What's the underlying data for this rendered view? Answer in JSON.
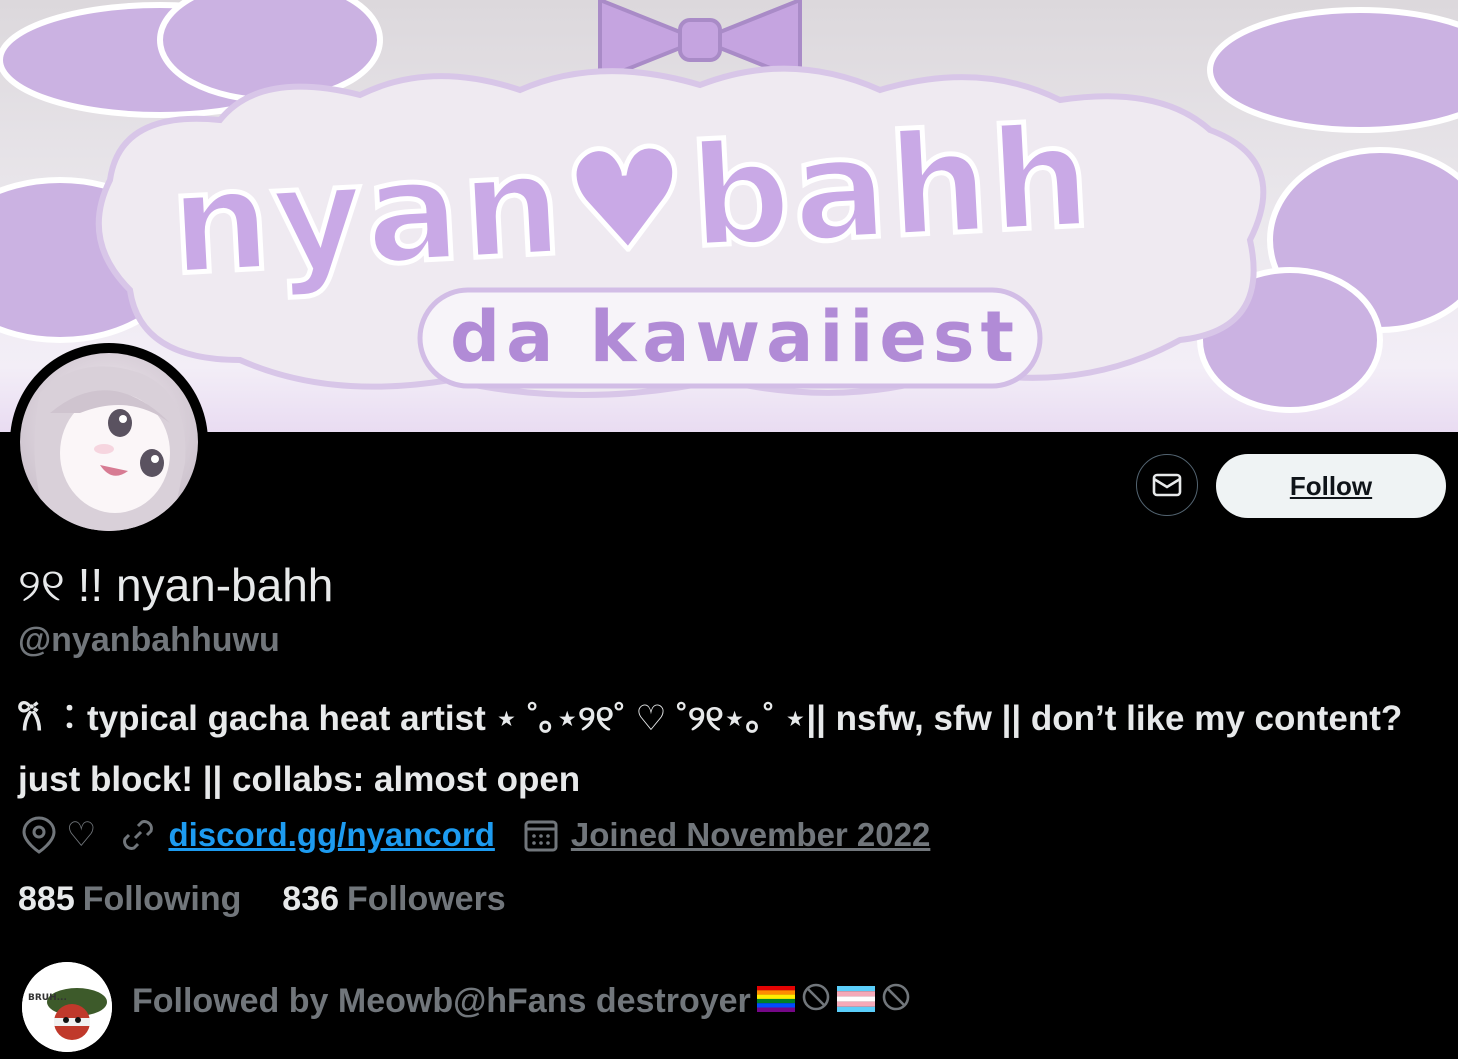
{
  "banner": {
    "title_text": "nyan♥bahh",
    "subtitle_text": "da kawaiiest"
  },
  "profile": {
    "display_name": "୨୧ !! nyan-bahh",
    "handle": "@nyanbahhuwu",
    "bio": "𐙚 ︰typical gacha heat artist ⋆ ˚｡⋆୨୧˚ ♡ ˚୨୧⋆｡˚ ⋆|| nsfw, sfw || don’t like my content? just block! || collabs: almost open",
    "location": "♡",
    "website": "discord.gg/nyancord",
    "joined": "Joined November 2022"
  },
  "actions": {
    "follow_label": "Follow"
  },
  "stats": {
    "following_count": "885",
    "following_label": "Following",
    "followers_count": "836",
    "followers_label": "Followers"
  },
  "followed_by": {
    "text": "Followed by Meowb@hFans destroyer",
    "avatar_caption": "BRUH..."
  },
  "icons": {
    "message": "envelope-icon",
    "location": "map-pin-icon",
    "link": "link-icon",
    "calendar": "calendar-icon",
    "flags": [
      "rainbow-flag-icon",
      "prohibited-icon",
      "trans-flag-icon",
      "prohibited-icon"
    ]
  },
  "colors": {
    "background": "#000000",
    "text_primary": "#e7e9ea",
    "text_secondary": "#71767b",
    "link": "#1d9bf0",
    "follow_button_bg": "#eff3f4",
    "banner_lavender": "#c8a9e0"
  }
}
